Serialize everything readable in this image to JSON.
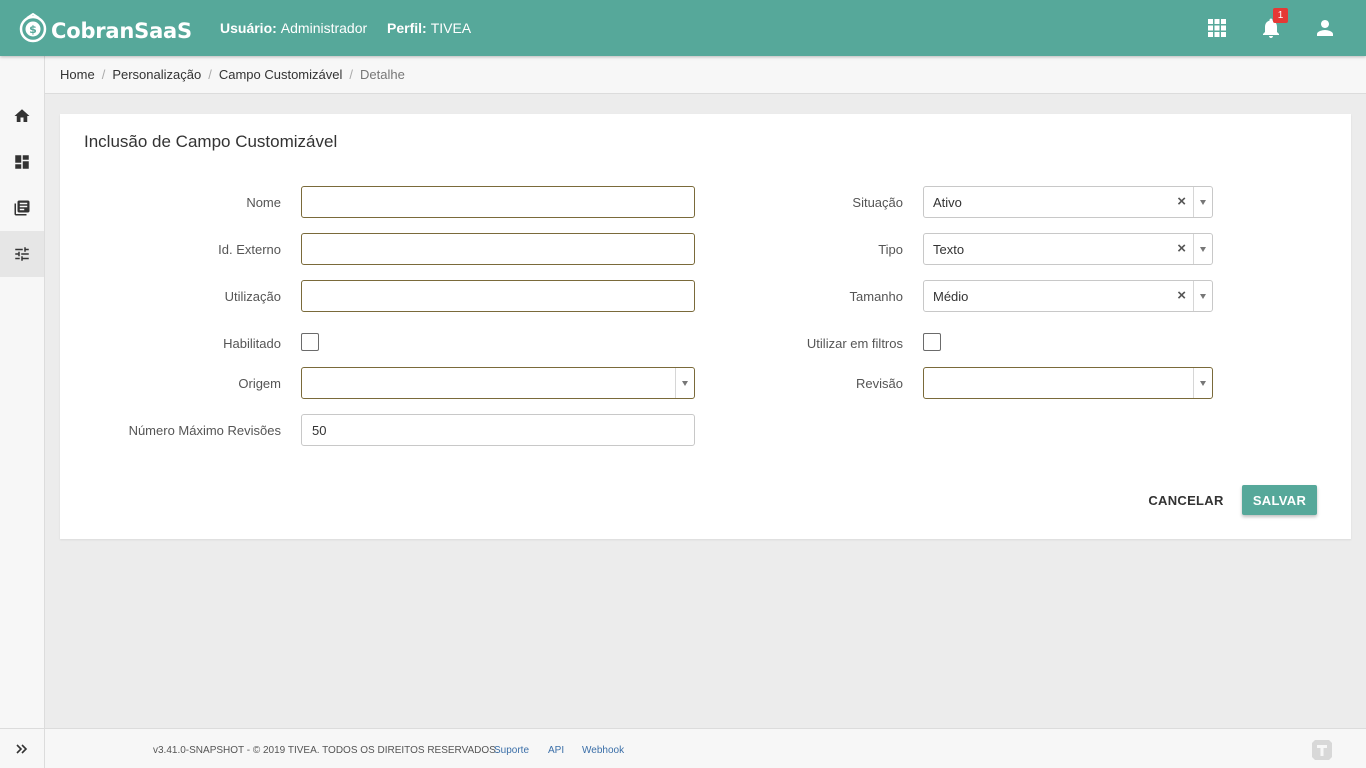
{
  "header": {
    "app_name": "CobranSaaS",
    "user_label": "Usuário:",
    "user_value": "Administrador",
    "profile_label": "Perfil:",
    "profile_value": "TIVEA",
    "notification_count": "1",
    "icons": [
      "apps-grid-icon",
      "bell-icon",
      "user-icon"
    ]
  },
  "sidebar": {
    "items": [
      {
        "icon": "home-icon"
      },
      {
        "icon": "dashboard-icon"
      },
      {
        "icon": "library-books-icon"
      },
      {
        "icon": "tune-sliders-icon",
        "active": true
      }
    ],
    "expand_icon": "double-chevron-right-icon"
  },
  "breadcrumb": {
    "items": [
      "Home",
      "Personalização",
      "Campo Customizável"
    ],
    "current": "Detalhe",
    "separator": "/"
  },
  "form": {
    "title": "Inclusão de Campo Customizável",
    "left": {
      "nome_label": "Nome",
      "nome_value": "",
      "id_externo_label": "Id. Externo",
      "id_externo_value": "",
      "utilizacao_label": "Utilização",
      "utilizacao_value": "",
      "habilitado_label": "Habilitado",
      "origem_label": "Origem",
      "origem_value": "",
      "max_revisoes_label": "Número Máximo Revisões",
      "max_revisoes_value": "50"
    },
    "right": {
      "situacao_label": "Situação",
      "situacao_value": "Ativo",
      "tipo_label": "Tipo",
      "tipo_value": "Texto",
      "tamanho_label": "Tamanho",
      "tamanho_value": "Médio",
      "utilizar_filtros_label": "Utilizar em filtros",
      "revisao_label": "Revisão",
      "revisao_value": ""
    },
    "clear_glyph": "×",
    "cancel_label": "CANCELAR",
    "save_label": "SALVAR"
  },
  "footer": {
    "copyright": "v3.41.0-SNAPSHOT - © 2019 TIVEA. TODOS OS DIREITOS RESERVADOS.",
    "links": [
      "Suporte",
      "API",
      "Webhook"
    ]
  },
  "colors": {
    "primary": "#56a89a",
    "field_border": "#7a6a3a",
    "badge": "#e53935",
    "link": "#3b6fa8"
  }
}
